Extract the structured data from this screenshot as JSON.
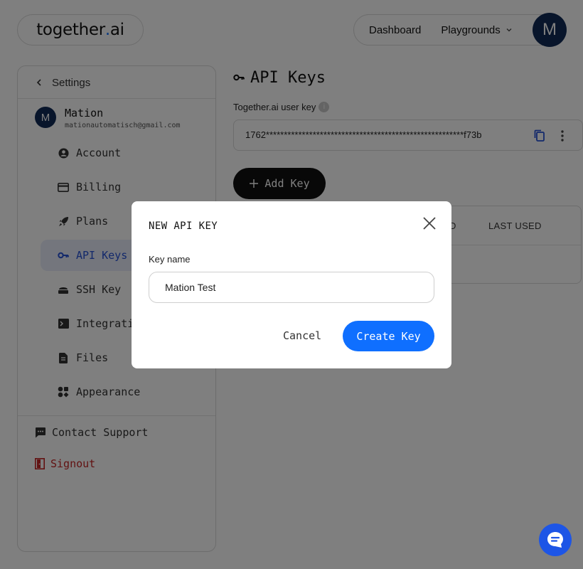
{
  "header": {
    "logo_text": "together",
    "logo_dot": ".",
    "logo_suffix": "ai",
    "nav": [
      "Dashboard",
      "Playgrounds"
    ],
    "nav_caret": "⌄",
    "avatar_initial": "M"
  },
  "sidebar": {
    "back_label": "Settings",
    "user": {
      "initial": "M",
      "name": "Mation",
      "email": "mationautomatisch@gmail.com"
    },
    "items": [
      {
        "label": "Account",
        "icon": "account-circle-icon"
      },
      {
        "label": "Billing",
        "icon": "credit-card-icon"
      },
      {
        "label": "Plans",
        "icon": "rocket-icon"
      },
      {
        "label": "API Keys",
        "icon": "key-icon",
        "active": true
      },
      {
        "label": "SSH Key",
        "icon": "ssh-key-icon"
      },
      {
        "label": "Integrations",
        "icon": "terminal-icon"
      },
      {
        "label": "Files",
        "icon": "file-icon"
      },
      {
        "label": "Appearance",
        "icon": "palette-icon"
      }
    ],
    "footer": [
      {
        "label": "Contact Support",
        "icon": "chat-bubble-icon"
      },
      {
        "label": "Signout",
        "icon": "exit-door-icon"
      }
    ]
  },
  "main": {
    "title": "API Keys",
    "user_key_label": "Together.ai user key",
    "user_key_value": "1762*******************************************************f73b",
    "add_key_label": "Add Key",
    "table_headers": [
      "ED",
      "LAST USED"
    ]
  },
  "modal": {
    "title": "NEW API KEY",
    "field_label": "Key name",
    "field_value": "Mation Test",
    "cancel_label": "Cancel",
    "create_label": "Create Key"
  },
  "colors": {
    "primary": "#0f6fff",
    "avatar_bg": "#102a56",
    "active_bg": "#e8ecfb",
    "danger": "#c42525"
  }
}
